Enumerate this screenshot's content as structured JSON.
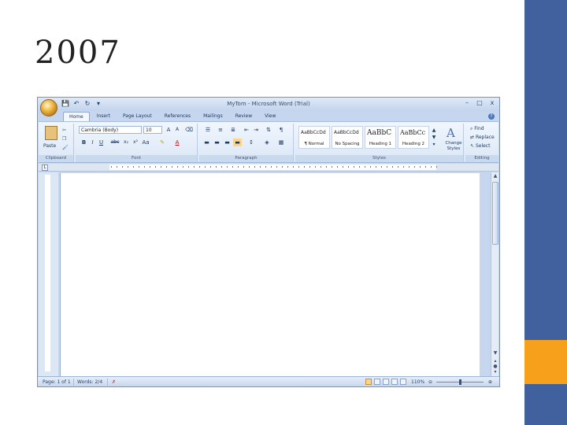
{
  "slide": {
    "title": "2007"
  },
  "window": {
    "title": "MyTom - Microsoft Word (Trial)",
    "controls": {
      "minimize": "–",
      "maximize": "□",
      "close": "x"
    },
    "qat": [
      "💾",
      "↶",
      "↻",
      "▾"
    ]
  },
  "ribbon": {
    "tabs": [
      "Home",
      "Insert",
      "Page Layout",
      "References",
      "Mailings",
      "Review",
      "View"
    ],
    "active_tab": "Home",
    "clipboard": {
      "paste": "Paste",
      "label": "Clipboard"
    },
    "font": {
      "name": "Cambria (Body)",
      "size": "10",
      "label": "Font"
    },
    "paragraph": {
      "label": "Paragraph"
    },
    "styles": {
      "items": [
        {
          "sample": "AaBbCcDd",
          "name": "¶ Normal"
        },
        {
          "sample": "AaBbCcDd",
          "name": "No Spacing"
        },
        {
          "sample": "AaBbC",
          "name": "Heading 1"
        },
        {
          "sample": "AaBbCc",
          "name": "Heading 2"
        }
      ],
      "change_styles": "Change Styles",
      "label": "Styles"
    },
    "editing": {
      "find": "Find",
      "replace": "Replace",
      "select": "Select",
      "label": "Editing"
    }
  },
  "status": {
    "page": "Page: 1 of 1",
    "words": "Words: 2/4",
    "zoom": "110%"
  },
  "colors": {
    "slide_accent_blue": "#41619e",
    "slide_accent_orange": "#f7a01c",
    "ribbon_bg": "#dbe7f6"
  }
}
